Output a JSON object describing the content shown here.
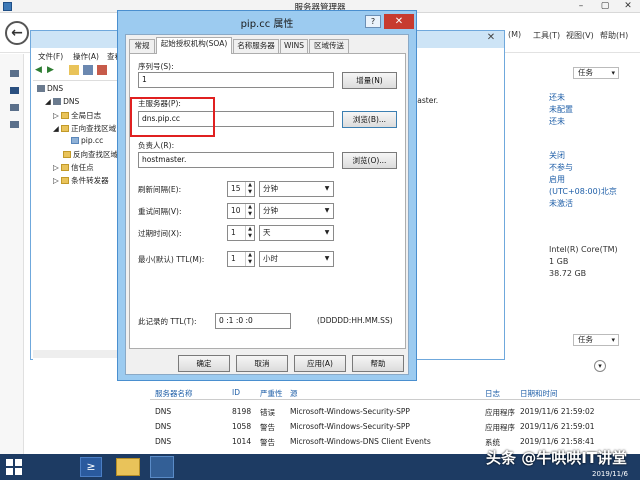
{
  "server_manager": {
    "title": "服务器管理器",
    "menus": [
      "(M)",
      "工具(T)",
      "视图(V)",
      "帮助(H)"
    ],
    "tasks_label": "任务",
    "status_top": [
      "还未",
      "未配置",
      "还未"
    ],
    "status_mid": [
      "关闭",
      "不参与",
      "启用",
      "(UTC+08:00)北京",
      "未激活"
    ],
    "hardware": [
      "Intel(R) Core(TM)",
      "1 GB",
      "38.72 GB"
    ],
    "events": {
      "headers": [
        "服务器名称",
        "ID",
        "严重性",
        "源",
        "日志",
        "日期和时间"
      ],
      "rows": [
        [
          "DNS",
          "8198",
          "错误",
          "Microsoft-Windows-Security-SPP",
          "应用程序",
          "2019/11/6 21:59:02"
        ],
        [
          "DNS",
          "1058",
          "警告",
          "Microsoft-Windows-Security-SPP",
          "应用程序",
          "2019/11/6 21:59:01"
        ],
        [
          "DNS",
          "1014",
          "警告",
          "Microsoft-Windows-DNS Client Events",
          "系统",
          "2019/11/6 21:58:41"
        ]
      ]
    }
  },
  "dns_manager": {
    "menus": [
      "文件(F)",
      "操作(A)",
      "查看"
    ],
    "tree": [
      "DNS",
      "DNS",
      "全局日志",
      "正向查找区域",
      "pip.cc",
      "反向查找区域",
      "信任点",
      "条件转发器"
    ],
    "right_text": "master."
  },
  "dialog": {
    "title": "pip.cc 属性",
    "help": "?",
    "close": "✕",
    "tabs": [
      "常规",
      "起始授权机构(SOA)",
      "名称服务器",
      "WINS",
      "区域传送"
    ],
    "serial_label": "序列号(S):",
    "serial_value": "1",
    "increment_button": "增量(N)",
    "primary_label": "主服务器(P):",
    "primary_value": "dns.pip.cc",
    "browse_b": "浏览(B)...",
    "responsible_label": "负责人(R):",
    "responsible_value": "hostmaster.",
    "browse_o": "浏览(O)...",
    "refresh_label": "刷新间隔(E):",
    "refresh_value": "15",
    "refresh_unit": "分钟",
    "retry_label": "重试间隔(V):",
    "retry_value": "10",
    "retry_unit": "分钟",
    "expire_label": "过期时间(X):",
    "expire_value": "1",
    "expire_unit": "天",
    "minttl_label": "最小(默认) TTL(M):",
    "minttl_value": "1",
    "minttl_unit": "小时",
    "record_ttl_label": "此记录的 TTL(T):",
    "record_ttl_value": "0      :1   :0   :0",
    "record_ttl_format": "(DDDDD:HH.MM.SS)",
    "ok_button": "确定",
    "cancel_button": "取消",
    "apply_button": "应用(A)",
    "help_button": "帮助"
  },
  "taskbar": {
    "ps_glyph": "≥",
    "watermark": "头条 @牛哄哄IT讲堂",
    "date": "2019/11/6"
  },
  "colors": {
    "accent": "#1f5fa8",
    "highlight": "#e02020",
    "taskbar": "#1d3b63",
    "dialog_frame": "#9ccbf0"
  }
}
